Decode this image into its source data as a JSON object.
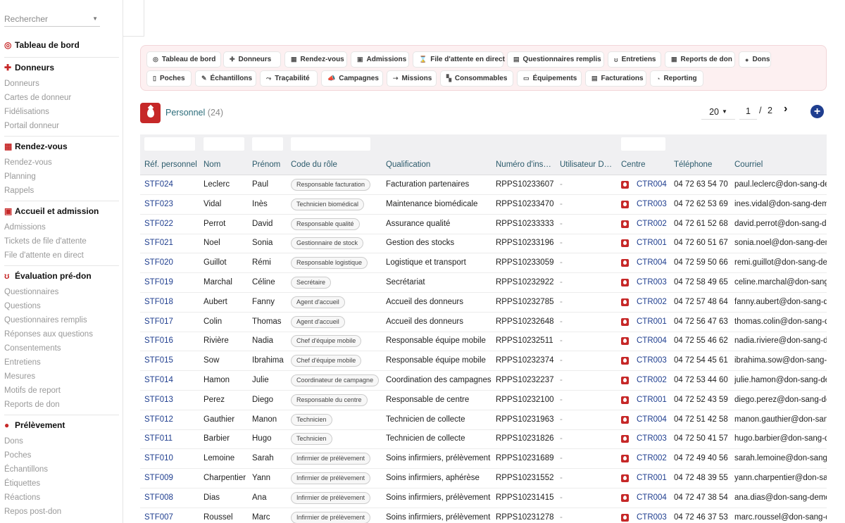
{
  "search": {
    "placeholder": "Rechercher"
  },
  "sidebar": {
    "sections": [
      {
        "title": "Tableau de bord",
        "icon": "dashboard-icon",
        "items": []
      },
      {
        "title": "Donneurs",
        "icon": "user-plus-icon",
        "items": [
          "Donneurs",
          "Cartes de donneur",
          "Fidélisations",
          "Portail donneur"
        ]
      },
      {
        "title": "Rendez-vous",
        "icon": "calendar-icon",
        "items": [
          "Rendez-vous",
          "Planning",
          "Rappels"
        ]
      },
      {
        "title": "Accueil et admission",
        "icon": "clipboard-check-icon",
        "items": [
          "Admissions",
          "Tickets de file d'attente",
          "File d'attente en direct"
        ]
      },
      {
        "title": "Évaluation pré-don",
        "icon": "stethoscope-icon",
        "items": [
          "Questionnaires",
          "Questions",
          "Questionnaires remplis",
          "Réponses aux questions",
          "Consentements",
          "Entretiens",
          "Mesures",
          "Motifs de report",
          "Reports de don"
        ]
      },
      {
        "title": "Prélèvement",
        "icon": "drop-icon",
        "items": [
          "Dons",
          "Poches",
          "Échantillons",
          "Étiquettes",
          "Réactions",
          "Repos post-don"
        ]
      }
    ]
  },
  "tabs": [
    {
      "label": "Tableau de bord",
      "icon": "dashboard-icon"
    },
    {
      "label": "Donneurs",
      "icon": "user-plus-icon"
    },
    {
      "label": "Rendez-vous",
      "icon": "calendar-icon"
    },
    {
      "label": "Admissions",
      "icon": "clipboard-icon"
    },
    {
      "label": "File d'attente en direct",
      "icon": "hourglass-icon"
    },
    {
      "label": "Questionnaires remplis",
      "icon": "form-icon"
    },
    {
      "label": "Entretiens",
      "icon": "stethoscope-icon"
    },
    {
      "label": "Reports de don",
      "icon": "calendar-x-icon"
    },
    {
      "label": "Dons",
      "icon": "drop-icon"
    },
    {
      "label": "Poches",
      "icon": "bag-icon"
    },
    {
      "label": "Échantillons",
      "icon": "pen-icon"
    },
    {
      "label": "Traçabilité",
      "icon": "network-icon"
    },
    {
      "label": "Campagnes",
      "icon": "megaphone-icon"
    },
    {
      "label": "Missions",
      "icon": "route-icon"
    },
    {
      "label": "Consommables",
      "icon": "boxes-icon"
    },
    {
      "label": "Équipements",
      "icon": "monitor-icon"
    },
    {
      "label": "Facturations",
      "icon": "invoice-icon"
    },
    {
      "label": "Reporting",
      "icon": "chart-pie-icon"
    }
  ],
  "header": {
    "title": "Personnel",
    "count": "(24)"
  },
  "pager": {
    "page_size": "20",
    "page": "1",
    "separator": "/",
    "total_pages": "2",
    "next": "›",
    "add": "+"
  },
  "table": {
    "columns": [
      "Réf. personnel",
      "Nom",
      "Prénom",
      "Code du rôle",
      "Qualification",
      "Numéro d'ins…",
      "Utilisateur D…",
      "Centre",
      "Téléphone",
      "Courriel"
    ],
    "rows": [
      {
        "ref": "STF024",
        "nom": "Leclerc",
        "prenom": "Paul",
        "role": "Responsable facturation",
        "qualif": "Facturation partenaires",
        "num": "RPPS10233607",
        "user": "-",
        "centre": "CTR004",
        "tel": "04 72 63 54 70",
        "mail": "paul.leclerc@don-sang-demo"
      },
      {
        "ref": "STF023",
        "nom": "Vidal",
        "prenom": "Inès",
        "role": "Technicien biomédical",
        "qualif": "Maintenance biomédicale",
        "num": "RPPS10233470",
        "user": "-",
        "centre": "CTR003",
        "tel": "04 72 62 53 69",
        "mail": "ines.vidal@don-sang-demo"
      },
      {
        "ref": "STF022",
        "nom": "Perrot",
        "prenom": "David",
        "role": "Responsable qualité",
        "qualif": "Assurance qualité",
        "num": "RPPS10233333",
        "user": "-",
        "centre": "CTR002",
        "tel": "04 72 61 52 68",
        "mail": "david.perrot@don-sang-demo"
      },
      {
        "ref": "STF021",
        "nom": "Noel",
        "prenom": "Sonia",
        "role": "Gestionnaire de stock",
        "qualif": "Gestion des stocks",
        "num": "RPPS10233196",
        "user": "-",
        "centre": "CTR001",
        "tel": "04 72 60 51 67",
        "mail": "sonia.noel@don-sang-demo"
      },
      {
        "ref": "STF020",
        "nom": "Guillot",
        "prenom": "Rémi",
        "role": "Responsable logistique",
        "qualif": "Logistique et transport",
        "num": "RPPS10233059",
        "user": "-",
        "centre": "CTR004",
        "tel": "04 72 59 50 66",
        "mail": "remi.guillot@don-sang-demo"
      },
      {
        "ref": "STF019",
        "nom": "Marchal",
        "prenom": "Céline",
        "role": "Secrétaire",
        "qualif": "Secrétariat",
        "num": "RPPS10232922",
        "user": "-",
        "centre": "CTR003",
        "tel": "04 72 58 49 65",
        "mail": "celine.marchal@don-sang-demo"
      },
      {
        "ref": "STF018",
        "nom": "Aubert",
        "prenom": "Fanny",
        "role": "Agent d'accueil",
        "qualif": "Accueil des donneurs",
        "num": "RPPS10232785",
        "user": "-",
        "centre": "CTR002",
        "tel": "04 72 57 48 64",
        "mail": "fanny.aubert@don-sang-demo"
      },
      {
        "ref": "STF017",
        "nom": "Colin",
        "prenom": "Thomas",
        "role": "Agent d'accueil",
        "qualif": "Accueil des donneurs",
        "num": "RPPS10232648",
        "user": "-",
        "centre": "CTR001",
        "tel": "04 72 56 47 63",
        "mail": "thomas.colin@don-sang-demo"
      },
      {
        "ref": "STF016",
        "nom": "Rivière",
        "prenom": "Nadia",
        "role": "Chef d'équipe mobile",
        "qualif": "Responsable équipe mobile",
        "num": "RPPS10232511",
        "user": "-",
        "centre": "CTR004",
        "tel": "04 72 55 46 62",
        "mail": "nadia.riviere@don-sang-demo"
      },
      {
        "ref": "STF015",
        "nom": "Sow",
        "prenom": "Ibrahima",
        "role": "Chef d'équipe mobile",
        "qualif": "Responsable équipe mobile",
        "num": "RPPS10232374",
        "user": "-",
        "centre": "CTR003",
        "tel": "04 72 54 45 61",
        "mail": "ibrahima.sow@don-sang-demo"
      },
      {
        "ref": "STF014",
        "nom": "Hamon",
        "prenom": "Julie",
        "role": "Coordinateur de campagne",
        "qualif": "Coordination des campagnes",
        "num": "RPPS10232237",
        "user": "-",
        "centre": "CTR002",
        "tel": "04 72 53 44 60",
        "mail": "julie.hamon@don-sang-demo"
      },
      {
        "ref": "STF013",
        "nom": "Perez",
        "prenom": "Diego",
        "role": "Responsable du centre",
        "qualif": "Responsable de centre",
        "num": "RPPS10232100",
        "user": "-",
        "centre": "CTR001",
        "tel": "04 72 52 43 59",
        "mail": "diego.perez@don-sang-demo"
      },
      {
        "ref": "STF012",
        "nom": "Gauthier",
        "prenom": "Manon",
        "role": "Technicien",
        "qualif": "Technicien de collecte",
        "num": "RPPS10231963",
        "user": "-",
        "centre": "CTR004",
        "tel": "04 72 51 42 58",
        "mail": "manon.gauthier@don-sang-demo"
      },
      {
        "ref": "STF011",
        "nom": "Barbier",
        "prenom": "Hugo",
        "role": "Technicien",
        "qualif": "Technicien de collecte",
        "num": "RPPS10231826",
        "user": "-",
        "centre": "CTR003",
        "tel": "04 72 50 41 57",
        "mail": "hugo.barbier@don-sang-demo"
      },
      {
        "ref": "STF010",
        "nom": "Lemoine",
        "prenom": "Sarah",
        "role": "Infirmier de prélèvement",
        "qualif": "Soins infirmiers, prélèvement",
        "num": "RPPS10231689",
        "user": "-",
        "centre": "CTR002",
        "tel": "04 72 49 40 56",
        "mail": "sarah.lemoine@don-sang-demo"
      },
      {
        "ref": "STF009",
        "nom": "Charpentier",
        "prenom": "Yann",
        "role": "Infirmier de prélèvement",
        "qualif": "Soins infirmiers, aphérèse",
        "num": "RPPS10231552",
        "user": "-",
        "centre": "CTR001",
        "tel": "04 72 48 39 55",
        "mail": "yann.charpentier@don-sang-demo"
      },
      {
        "ref": "STF008",
        "nom": "Dias",
        "prenom": "Ana",
        "role": "Infirmier de prélèvement",
        "qualif": "Soins infirmiers, prélèvement",
        "num": "RPPS10231415",
        "user": "-",
        "centre": "CTR004",
        "tel": "04 72 47 38 54",
        "mail": "ana.dias@don-sang-demo"
      },
      {
        "ref": "STF007",
        "nom": "Roussel",
        "prenom": "Marc",
        "role": "Infirmier de prélèvement",
        "qualif": "Soins infirmiers, prélèvement",
        "num": "RPPS10231278",
        "user": "-",
        "centre": "CTR003",
        "tel": "04 72 46 37 53",
        "mail": "marc.roussel@don-sang-demo"
      }
    ]
  },
  "colors": {
    "accent": "#c62828",
    "link": "#1f3e8f",
    "tab_panel_bg": "#fdf0f1",
    "header_text": "#2b6c7a"
  }
}
